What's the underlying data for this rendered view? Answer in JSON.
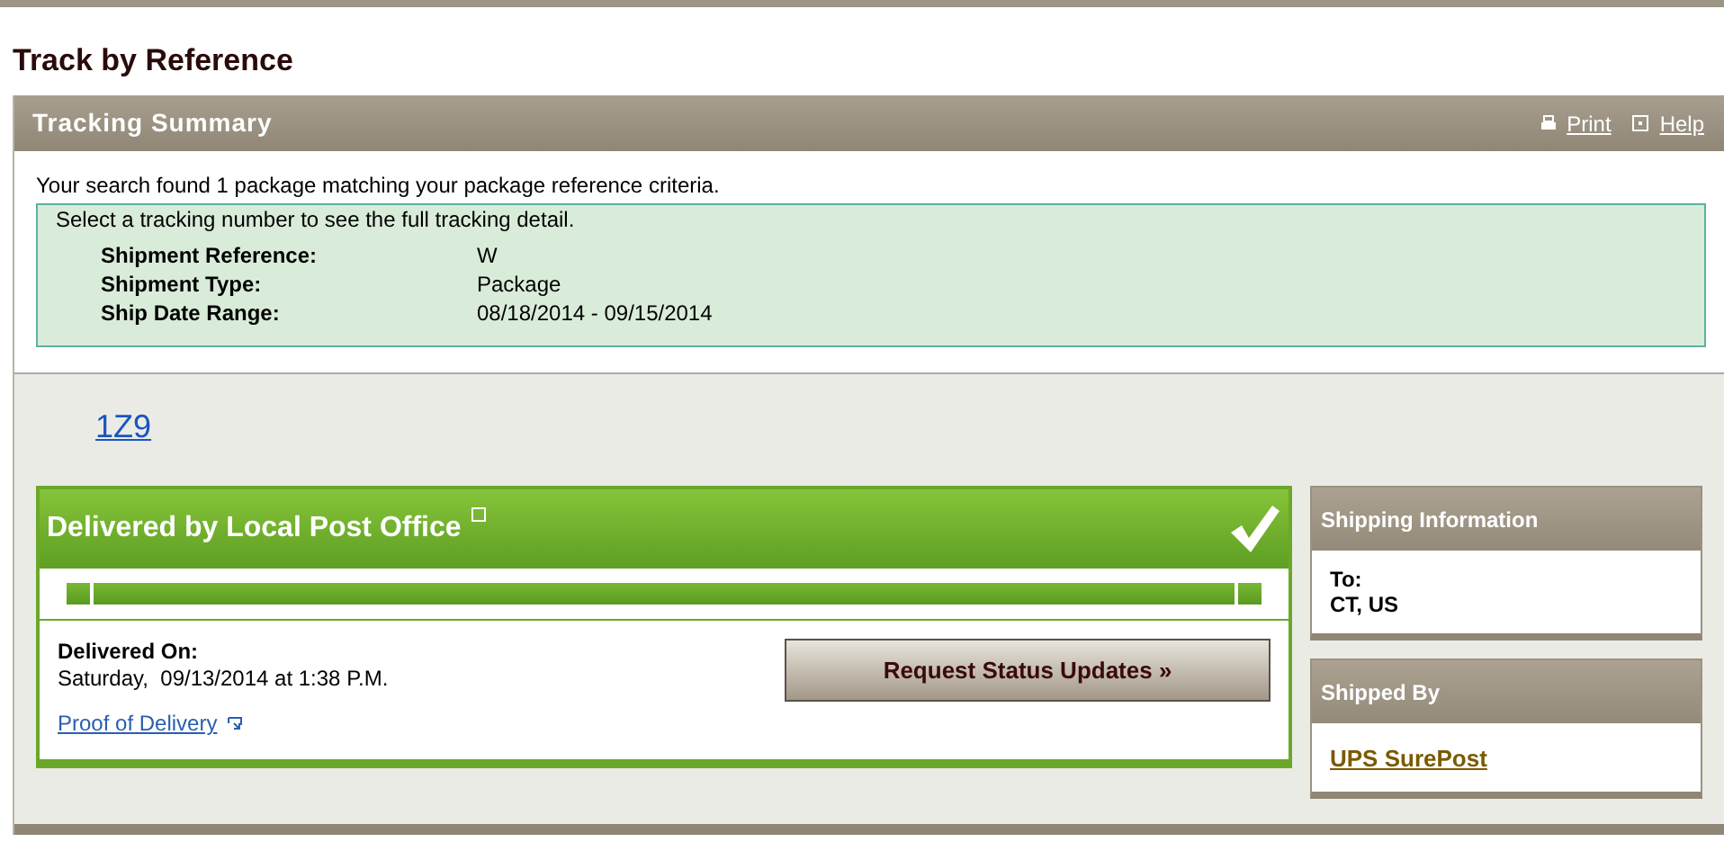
{
  "page_title": "Track by Reference",
  "summary": {
    "title": "Tracking Summary",
    "links": [
      {
        "kind": "print",
        "label": "Print"
      },
      {
        "kind": "help",
        "label": "Help"
      }
    ],
    "message": "Your search found 1 package matching your package reference criteria.",
    "instruction": "Select a tracking number to see the full tracking detail.",
    "details": [
      {
        "label": "Shipment Reference:",
        "value": "W"
      },
      {
        "label": "Shipment Type:",
        "value": "Package"
      },
      {
        "label": "Ship Date Range:",
        "value": "08/18/2014 - 09/15/2014"
      }
    ]
  },
  "tracking_number": "1Z9",
  "status": {
    "title": "Delivered by Local Post Office",
    "delivered": true,
    "level": 1,
    "delivered_label": "Delivered On:",
    "delivered_value": "Saturday,  09/13/2014 at 1:38 P.M.",
    "proof_link": "Proof of Delivery",
    "button": "Request Status Updates »"
  },
  "shipping_info": {
    "title": "Shipping Information",
    "lines": [
      "To:",
      "CT, US"
    ]
  },
  "shipped_by": {
    "title": "Shipped By",
    "carrier": "UPS SurePost"
  }
}
